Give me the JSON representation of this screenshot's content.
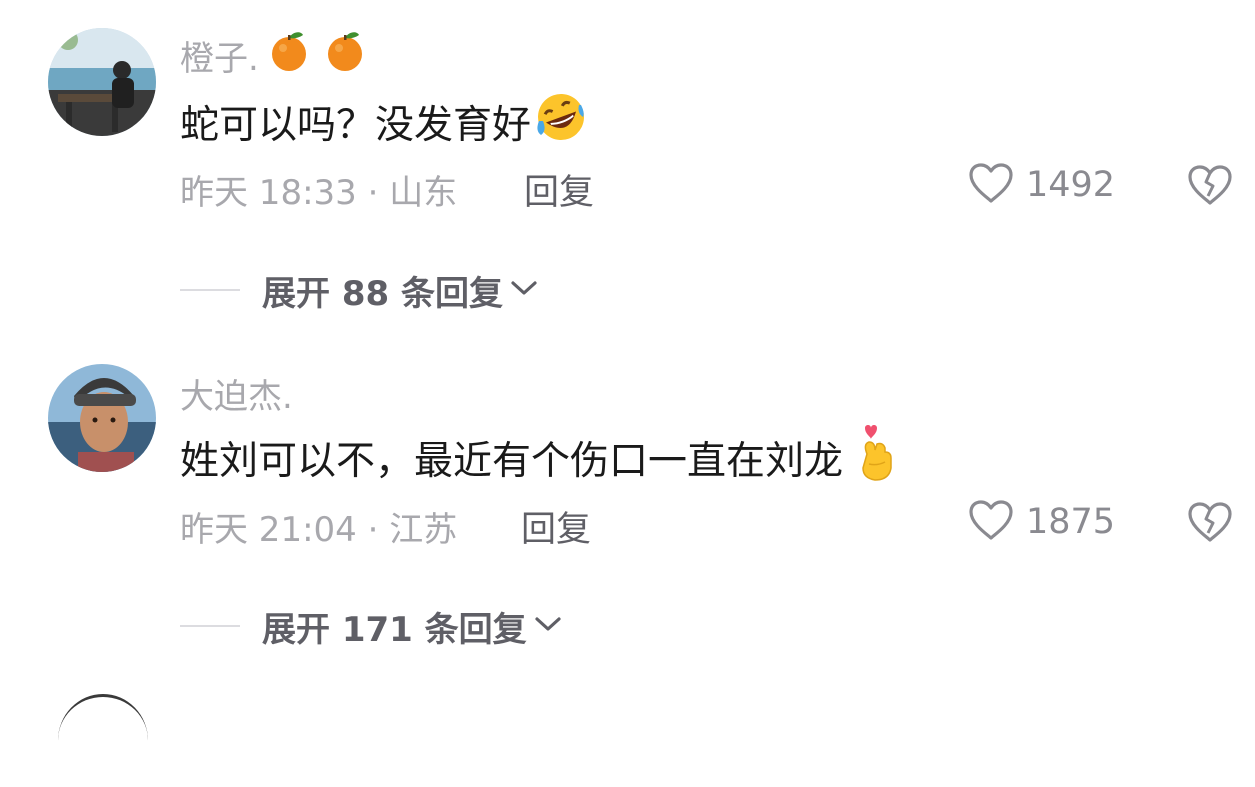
{
  "comments": [
    {
      "username": "橙子.",
      "username_emojis": [
        "tangerine-icon",
        "tangerine-icon"
      ],
      "text": "蛇可以吗？没发育好",
      "text_emoji": "rolling-laughing-icon",
      "time_location": "昨天 18:33 · 山东",
      "reply_label": "回复",
      "likes": "1492",
      "expand_label": "展开 88 条回复"
    },
    {
      "username": "大迫杰.",
      "text": "姓刘可以不，最近有个伤口一直在刘龙",
      "text_emoji": "finger-heart-icon",
      "time_location": "昨天 21:04 · 江苏",
      "reply_label": "回复",
      "likes": "1875",
      "expand_label": "展开 171 条回复"
    }
  ],
  "colors": {
    "username": "#a8a8ad",
    "body_text": "#1a1a1a",
    "meta": "#a8a8ad",
    "action": "#5f5f66",
    "tangerine": "#f28a1c"
  }
}
